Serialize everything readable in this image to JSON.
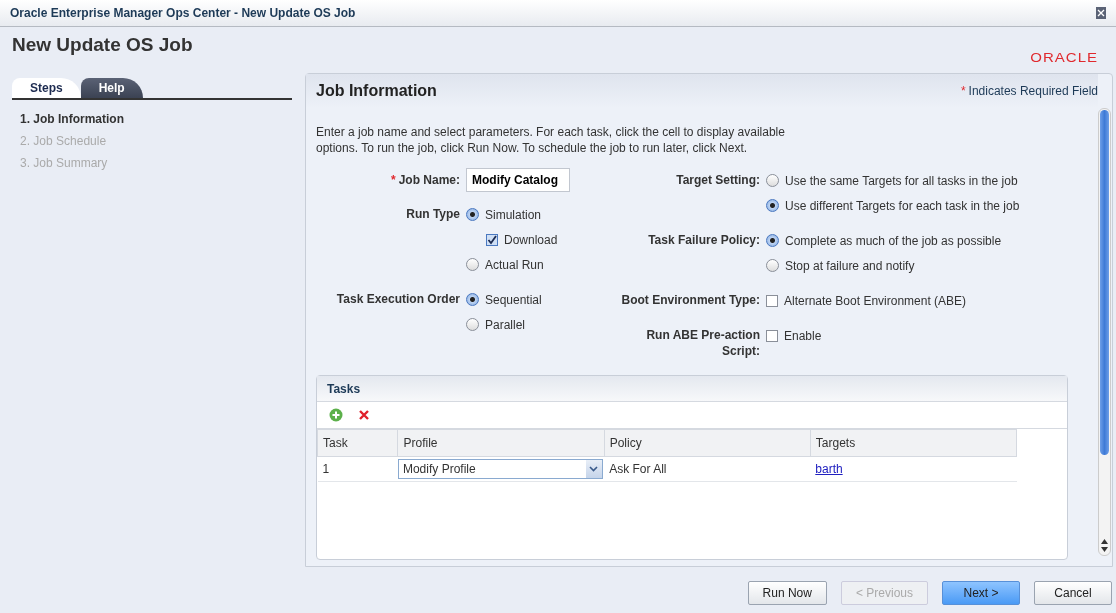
{
  "window": {
    "title": "Oracle Enterprise Manager Ops Center - New Update OS Job"
  },
  "page_title": "New Update OS Job",
  "logo": "ORACLE",
  "side_tabs": [
    {
      "label": "Steps",
      "selected": true
    },
    {
      "label": "Help",
      "selected": false
    }
  ],
  "steps": [
    {
      "label": "1. Job Information",
      "selected": true
    },
    {
      "label": "2. Job Schedule",
      "selected": false
    },
    {
      "label": "3. Job Summary",
      "selected": false
    }
  ],
  "panel": {
    "title": "Job Information",
    "required_mark": "*",
    "required_note": "Indicates Required Field",
    "instructions": "Enter a job name and select parameters. For each task, click the cell to display available options. To run the job, click Run Now. To schedule the job to run later, click Next."
  },
  "form_left": [
    {
      "kind": "text",
      "label": "Job Name:",
      "required": true,
      "value": "Modify Catalog"
    },
    {
      "kind": "choice",
      "label": "Run Type",
      "options": [
        {
          "kind": "radio",
          "label": "Simulation",
          "selected": true,
          "children": [
            {
              "kind": "checkbox",
              "label": "Download",
              "checked": true
            }
          ]
        },
        {
          "kind": "radio",
          "label": "Actual Run",
          "selected": false
        }
      ]
    },
    {
      "kind": "choice",
      "label": "Task Execution Order",
      "options": [
        {
          "kind": "radio",
          "label": "Sequential",
          "selected": true
        },
        {
          "kind": "radio",
          "label": "Parallel",
          "selected": false
        }
      ]
    }
  ],
  "form_right": [
    {
      "kind": "choice",
      "label": "Target Setting:",
      "options": [
        {
          "kind": "radio",
          "label": "Use the same Targets for all tasks in the job",
          "selected": false
        },
        {
          "kind": "radio",
          "label": "Use different Targets for each task in the job",
          "selected": true
        }
      ]
    },
    {
      "kind": "choice",
      "label": "Task Failure Policy:",
      "options": [
        {
          "kind": "radio",
          "label": "Complete as much of the job as possible",
          "selected": true
        },
        {
          "kind": "radio",
          "label": "Stop at failure and notify",
          "selected": false
        }
      ]
    },
    {
      "kind": "choice",
      "label": "Boot Environment Type:",
      "options": [
        {
          "kind": "checkbox",
          "label": "Alternate Boot Environment (ABE)",
          "checked": false
        }
      ]
    },
    {
      "kind": "choice",
      "label": "Run ABE Pre-action Script:",
      "options": [
        {
          "kind": "checkbox",
          "label": "Enable",
          "checked": false
        }
      ]
    }
  ],
  "tasks": {
    "title": "Tasks",
    "columns": [
      "Task",
      "Profile",
      "Policy",
      "Targets"
    ],
    "rows": [
      {
        "task": "1",
        "profile": "Modify Profile",
        "policy": "Ask For All",
        "targets": "barth"
      }
    ]
  },
  "buttons": [
    {
      "label": "Run Now",
      "disabled": false,
      "primary": false
    },
    {
      "label": "< Previous",
      "disabled": true,
      "primary": false
    },
    {
      "label": "Next >",
      "disabled": false,
      "primary": true
    },
    {
      "label": "Cancel",
      "disabled": false,
      "primary": false
    }
  ]
}
